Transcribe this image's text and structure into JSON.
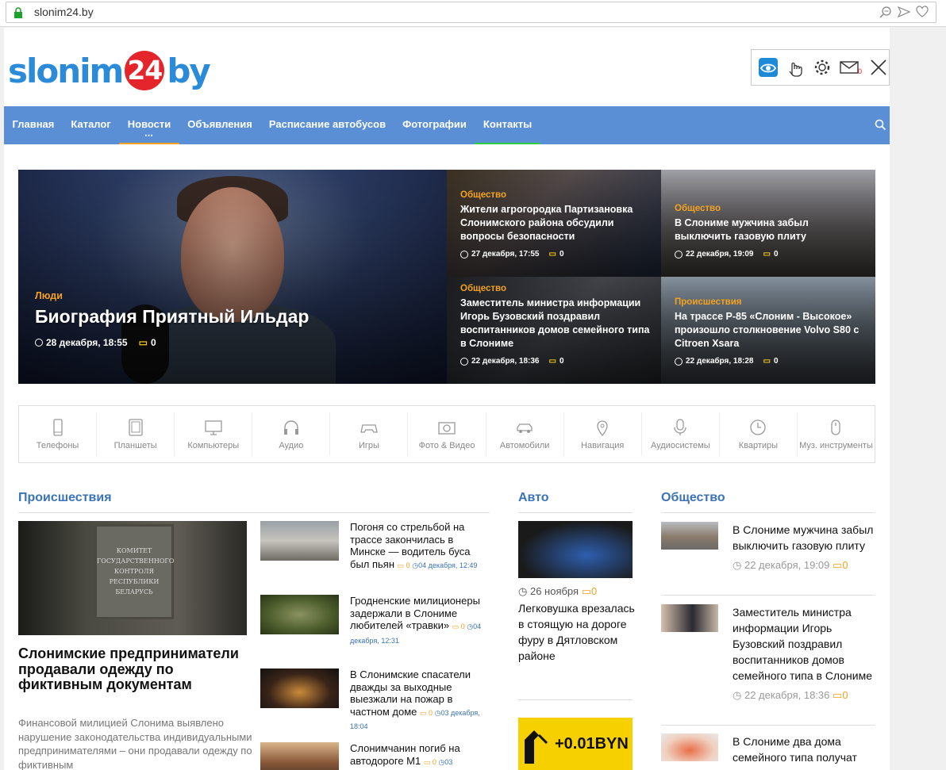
{
  "browser": {
    "url": "slonim24.by"
  },
  "logo": {
    "part1": "slonim",
    "part2": "24",
    "part3": "by"
  },
  "access": {
    "badge": "0"
  },
  "nav": {
    "items": [
      "Главная",
      "Каталог",
      "Новости",
      "Объявления",
      "Расписание автобусов",
      "Фотографии",
      "Контакты"
    ],
    "more": "⋯"
  },
  "hero": {
    "main": {
      "category": "Люди",
      "title": "Биография Приятный Ильдар",
      "date": "28 декабря, 18:55",
      "comments": "0"
    },
    "tiles": [
      {
        "category": "Общество",
        "title": "Жители агрогородка Партизановка Слонимского района обсудили вопросы безопасности",
        "date": "27 декабря, 17:55",
        "comments": "0"
      },
      {
        "category": "Общество",
        "title": "В Слониме мужчина забыл выключить газовую плиту",
        "date": "22 декабря, 19:09",
        "comments": "0"
      },
      {
        "category": "Общество",
        "title": "Заместитель министра информации Игорь Бузовский поздравил воспитанников домов семейного типа в Слониме",
        "date": "22 декабря, 18:36",
        "comments": "0"
      },
      {
        "category": "Происшествия",
        "title": "На трассе Р-85 «Слоним - Высокое» произошло столкновение Volvo S80 с Citroen Xsara",
        "date": "22 декабря, 18:28",
        "comments": "0"
      }
    ]
  },
  "catalog": [
    {
      "label": "Телефоны",
      "icon": "phone-icon"
    },
    {
      "label": "Планшеты",
      "icon": "tablet-icon"
    },
    {
      "label": "Компьютеры",
      "icon": "computer-icon"
    },
    {
      "label": "Аудио",
      "icon": "headphones-icon"
    },
    {
      "label": "Игры",
      "icon": "gamepad-icon"
    },
    {
      "label": "Фото & Видео",
      "icon": "camera-icon"
    },
    {
      "label": "Автомобили",
      "icon": "car-icon"
    },
    {
      "label": "Навигация",
      "icon": "location-icon"
    },
    {
      "label": "Аудиосистемы",
      "icon": "microphone-icon"
    },
    {
      "label": "Квартиры",
      "icon": "clock-icon"
    },
    {
      "label": "Муз. инструменты",
      "icon": "mouse-icon"
    }
  ],
  "sections": {
    "incidents": {
      "title": "Происшествия",
      "featured": {
        "plaque": "КОМИТЕТ ГОСУДАРСТВЕННОГО КОНТРОЛЯ РЕСПУБЛИКИ БЕЛАРУСЬ",
        "title": "Слонимские предприниматели продавали одежду по фиктивным документам",
        "excerpt": "Финансовой милицией Слонима выявлено нарушение законодательства индивидуальными предпринимателями – они продавали одежду по фиктивным"
      },
      "items": [
        {
          "title": "Погоня со стрельбой на трассе закончилась в Минске — водитель буса был пьян",
          "comments": "0",
          "date": "04 декабря, 12:49"
        },
        {
          "title": "Гродненские милиционеры задержали в Слониме любителей «травки»",
          "comments": "0",
          "date": "04 декабря, 12:31"
        },
        {
          "title": "В Слонимские спасатели дважды за выходные выезжали на пожар в частном доме",
          "comments": "0",
          "date": "03 декабря, 18:04"
        },
        {
          "title": "Слонимчанин погиб на автодороге М1",
          "comments": "0",
          "date": "03"
        }
      ]
    },
    "auto": {
      "title": "Авто",
      "date": "26 ноября",
      "comments": "0",
      "text": "Легковушка врезалась в стоящую на дороге фуру в Дятловском районе",
      "promo_text": "+0.01BYN"
    },
    "society": {
      "title": "Общество",
      "items": [
        {
          "title": "В Слониме мужчина забыл выключить газовую плиту",
          "date": "22 декабря, 19:09",
          "comments": "0"
        },
        {
          "title": "Заместитель министра информации Игорь Бузовский поздравил воспитанников домов семейного типа в Слониме",
          "date": "22 декабря, 18:36",
          "comments": "0"
        },
        {
          "title": "В Слониме два дома семейного типа получат",
          "date": "",
          "comments": ""
        }
      ]
    }
  },
  "colors": {
    "accent": "#5a8fd5",
    "orange": "#f4a21f",
    "green": "#2ecc40",
    "logoBlue": "#2b8bd8",
    "logoRed": "#e4262c"
  }
}
